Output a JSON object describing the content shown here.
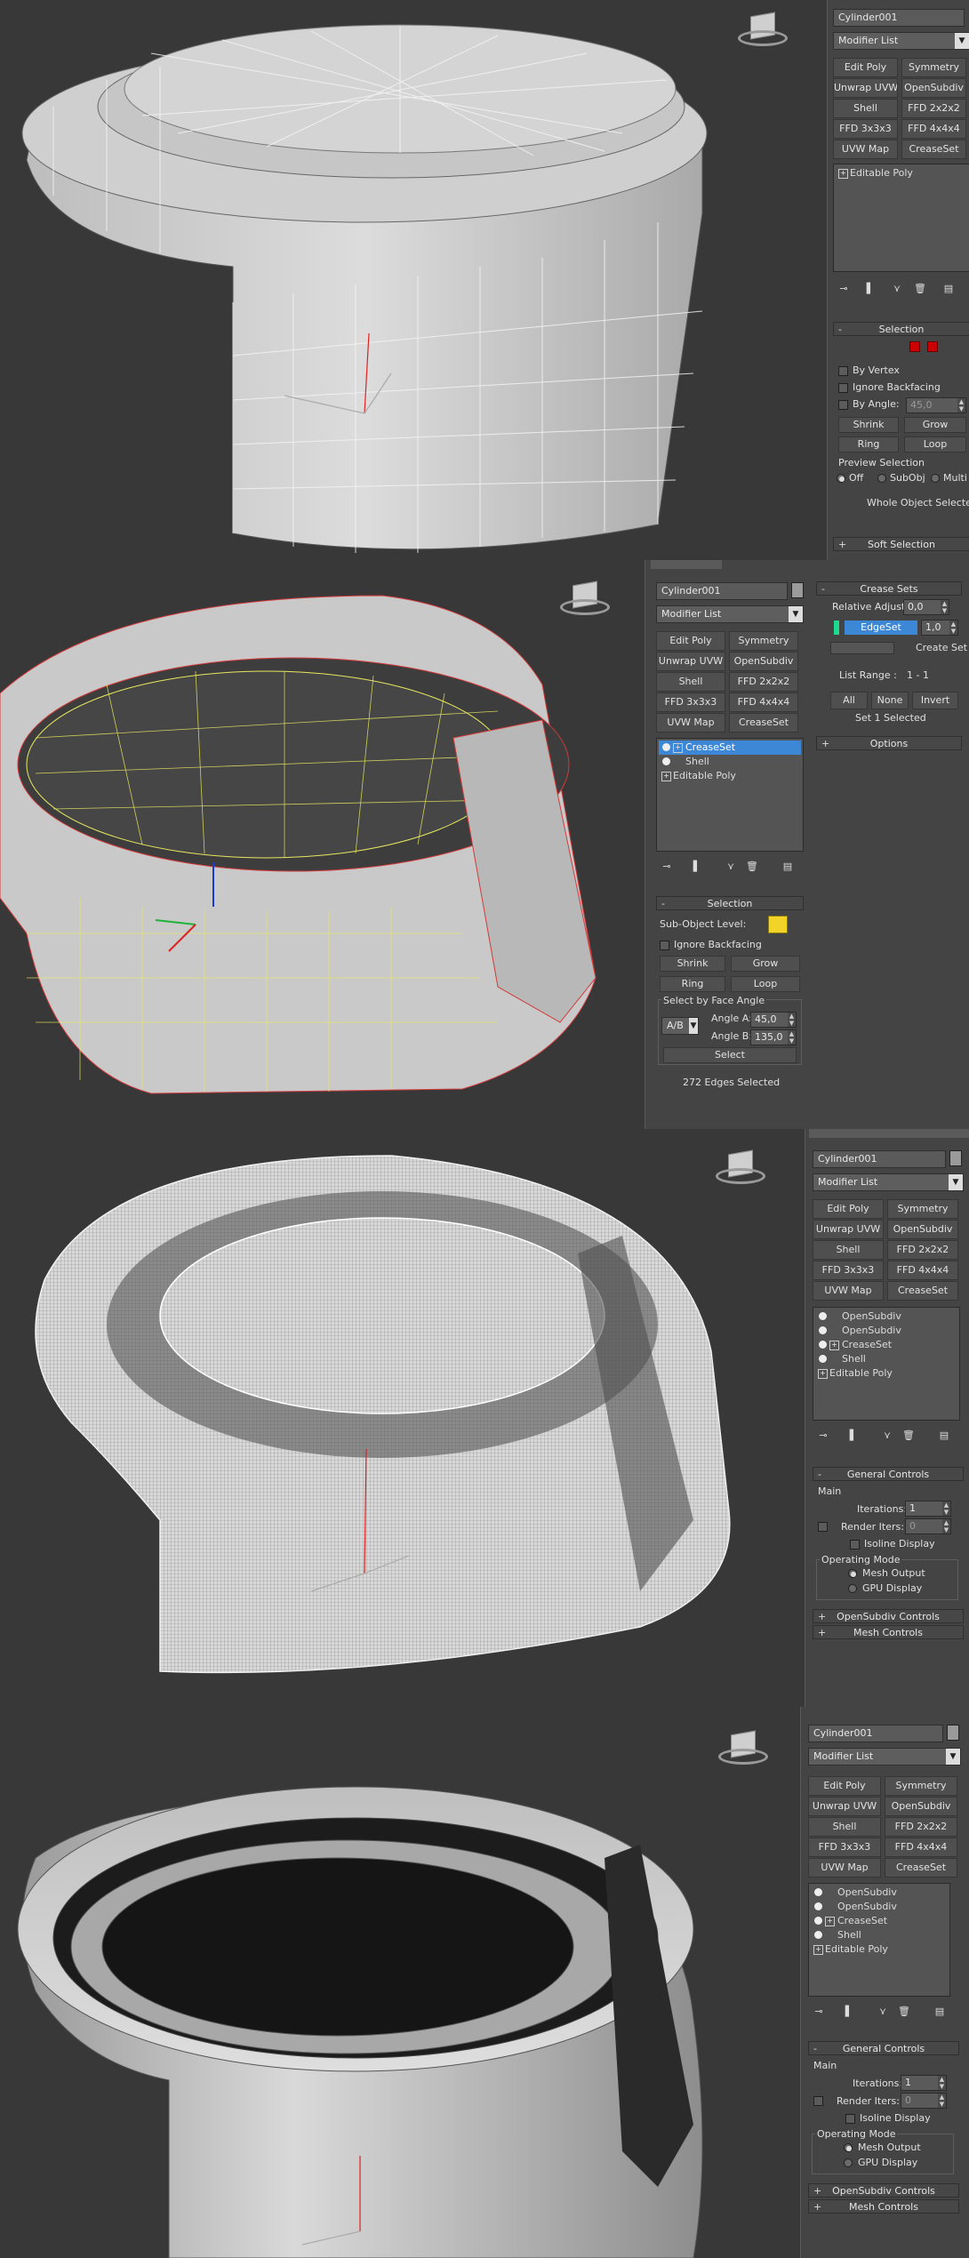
{
  "screens": [
    {
      "object_name": "Cylinder001",
      "modifier_list_label": "Modifier List",
      "modifier_buttons": [
        "Edit Poly",
        "Symmetry",
        "Unwrap UVW",
        "OpenSubdiv",
        "Shell",
        "FFD 2x2x2",
        "FFD 3x3x3",
        "FFD 4x4x4",
        "UVW Map",
        "CreaseSet"
      ],
      "stack": [
        "Editable Poly"
      ],
      "selection": {
        "title": "Selection",
        "by_vertex": "By Vertex",
        "ignore_backfacing": "Ignore Backfacing",
        "by_angle": "By Angle:",
        "by_angle_value": "45,0",
        "shrink": "Shrink",
        "grow": "Grow",
        "ring": "Ring",
        "loop": "Loop",
        "preview_selection": "Preview Selection",
        "preview_off": "Off",
        "preview_subobj": "SubObj",
        "preview_multi": "Multi",
        "status": "Whole Object Selected"
      },
      "soft_selection": "Soft Selection"
    },
    {
      "object_name": "Cylinder001",
      "modifier_list_label": "Modifier List",
      "modifier_buttons": [
        "Edit Poly",
        "Symmetry",
        "Unwrap UVW",
        "OpenSubdiv",
        "Shell",
        "FFD 2x2x2",
        "FFD 3x3x3",
        "FFD 4x4x4",
        "UVW Map",
        "CreaseSet"
      ],
      "stack": [
        "CreaseSet",
        "Shell",
        "Editable Poly"
      ],
      "selection": {
        "title": "Selection",
        "sub_object_level": "Sub-Object Level:",
        "ignore_backfacing": "Ignore Backfacing",
        "shrink": "Shrink",
        "grow": "Grow",
        "ring": "Ring",
        "loop": "Loop",
        "select_by_face_angle": "Select by Face Angle",
        "ab": "A/B",
        "angle_a_label": "Angle A:",
        "angle_a": "45,0",
        "angle_b_label": "Angle B:",
        "angle_b": "135,0",
        "select": "Select",
        "status": "272 Edges Selected"
      },
      "crease_sets": {
        "title": "Crease Sets",
        "relative_adjust": "Relative Adjust:",
        "relative_adjust_value": "0,0",
        "set_name": "EdgeSet",
        "set_value": "1,0",
        "create_set": "Create Set",
        "list_range": "List Range :",
        "list_range_value": "1 - 1",
        "all": "All",
        "none": "None",
        "invert": "Invert",
        "status": "Set 1 Selected"
      },
      "options": "Options"
    },
    {
      "object_name": "Cylinder001",
      "modifier_list_label": "Modifier List",
      "modifier_buttons": [
        "Edit Poly",
        "Symmetry",
        "Unwrap UVW",
        "OpenSubdiv",
        "Shell",
        "FFD 2x2x2",
        "FFD 3x3x3",
        "FFD 4x4x4",
        "UVW Map",
        "CreaseSet"
      ],
      "stack": [
        "OpenSubdiv",
        "OpenSubdiv",
        "CreaseSet",
        "Shell",
        "Editable Poly"
      ],
      "general_controls": {
        "title": "General Controls",
        "main": "Main",
        "iterations_label": "Iterations:",
        "iterations": "1",
        "render_iters_label": "Render Iters:",
        "render_iters": "0",
        "isoline_display": "Isoline Display",
        "operating_mode": "Operating Mode",
        "mesh_output": "Mesh Output",
        "gpu_display": "GPU Display"
      },
      "opensubdiv_controls": "OpenSubdiv Controls",
      "mesh_controls": "Mesh Controls"
    },
    {
      "object_name": "Cylinder001",
      "modifier_list_label": "Modifier List",
      "modifier_buttons": [
        "Edit Poly",
        "Symmetry",
        "Unwrap UVW",
        "OpenSubdiv",
        "Shell",
        "FFD 2x2x2",
        "FFD 3x3x3",
        "FFD 4x4x4",
        "UVW Map",
        "CreaseSet"
      ],
      "stack": [
        "OpenSubdiv",
        "OpenSubdiv",
        "CreaseSet",
        "Shell",
        "Editable Poly"
      ],
      "general_controls": {
        "title": "General Controls",
        "main": "Main",
        "iterations_label": "Iterations:",
        "iterations": "1",
        "render_iters_label": "Render Iters:",
        "render_iters": "0",
        "isoline_display": "Isoline Display",
        "operating_mode": "Operating Mode",
        "mesh_output": "Mesh Output",
        "gpu_display": "GPU Display"
      },
      "opensubdiv_controls": "OpenSubdiv Controls",
      "mesh_controls": "Mesh Controls"
    }
  ],
  "colors": {
    "viewport_bg": "#383838",
    "panel_bg": "#444444",
    "selection_blue": "#3c87d6",
    "edge_red": "#d23a3a",
    "edge_yellow": "#e8e860",
    "crease_green": "#1ed98e",
    "sub_object_yellow": "#f2d327"
  },
  "icons": [
    "view-cube-icon",
    "eye-icon",
    "pin-stack-icon",
    "show-end-result-icon",
    "make-unique-icon",
    "remove-modifier-icon",
    "configure-sets-icon",
    "gizmo-axis-icon"
  ]
}
